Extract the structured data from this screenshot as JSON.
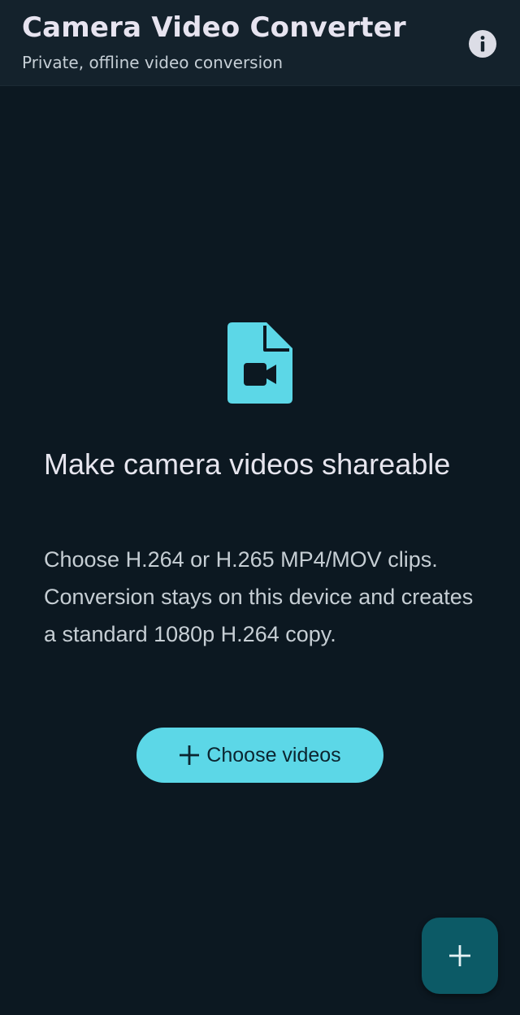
{
  "app_bar": {
    "title": "Camera Video Converter",
    "subtitle": "Private, offline video conversion",
    "info_icon": "info-icon"
  },
  "empty_state": {
    "icon": "video-file-icon",
    "heading": "Make camera videos shareable",
    "body": "Choose H.264 or H.265 MP4/MOV clips. Conversion stays on this device and creates a standard 1080p H.264 copy.",
    "button_label": "Choose videos",
    "button_icon": "plus-icon"
  },
  "fab": {
    "icon": "plus-icon"
  },
  "colors": {
    "background": "#0c1821",
    "app_bar": "#14222c",
    "accent": "#5cd7e7",
    "fab": "#0c5a66"
  }
}
